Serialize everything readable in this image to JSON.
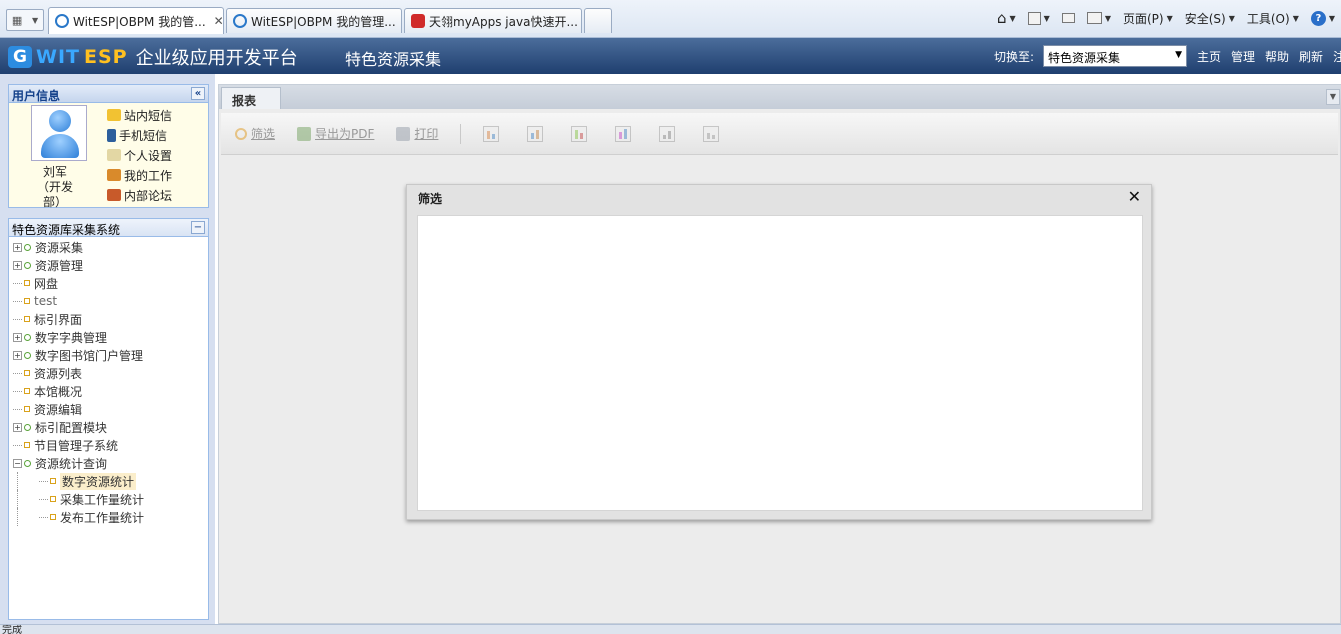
{
  "browser": {
    "tabs": [
      {
        "label": "WitESP|OBPM 我的管...",
        "active": true
      },
      {
        "label": "WitESP|OBPM 我的管理...",
        "active": false
      },
      {
        "label": "天翎myApps java快速开...",
        "active": false
      }
    ],
    "tab_close": "✕",
    "commands": [
      "页面(P)",
      "安全(S)",
      "工具(O)"
    ]
  },
  "header": {
    "logo_wit": "WIT",
    "logo_esp": "ESP",
    "logo_sub": "企业级应用开发平台",
    "title": "特色资源采集",
    "switch_label": "切换至:",
    "switch_value": "特色资源采集",
    "links": [
      "主页",
      "管理",
      "帮助",
      "刷新",
      "注"
    ]
  },
  "user_panel": {
    "title": "用户信息",
    "collapse_glyph": "«",
    "name": "刘军（开发部）",
    "links": [
      "站内短信",
      "手机短信",
      "个人设置",
      "我的工作",
      "内部论坛"
    ]
  },
  "tree_panel": {
    "title": "特色资源库采集系统",
    "collapse_glyph": "−",
    "items": [
      {
        "label": "资源采集",
        "type": "folder",
        "expanded": false
      },
      {
        "label": "资源管理",
        "type": "folder",
        "expanded": false
      },
      {
        "label": "网盘",
        "type": "leaf"
      },
      {
        "label": "test",
        "type": "leaf"
      },
      {
        "label": "标引界面",
        "type": "leaf"
      },
      {
        "label": "数字字典管理",
        "type": "folder",
        "expanded": false
      },
      {
        "label": "数字图书馆门户管理",
        "type": "folder",
        "expanded": false
      },
      {
        "label": "资源列表",
        "type": "leaf"
      },
      {
        "label": "本馆概况",
        "type": "leaf"
      },
      {
        "label": "资源编辑",
        "type": "leaf"
      },
      {
        "label": "标引配置模块",
        "type": "folder",
        "expanded": false
      },
      {
        "label": "节目管理子系统",
        "type": "leaf"
      },
      {
        "label": "资源统计查询",
        "type": "folder",
        "expanded": true
      }
    ],
    "children": [
      {
        "label": "数字资源统计",
        "selected": true
      },
      {
        "label": "采集工作量统计",
        "selected": false
      },
      {
        "label": "发布工作量统计",
        "selected": false
      }
    ]
  },
  "main": {
    "tab_label": "报表",
    "toolbar": {
      "filter": "筛选",
      "export_pdf": "导出为PDF",
      "print": "打印"
    }
  },
  "dialog": {
    "title": "筛选",
    "close": "✕"
  },
  "status": {
    "text": "完成"
  }
}
